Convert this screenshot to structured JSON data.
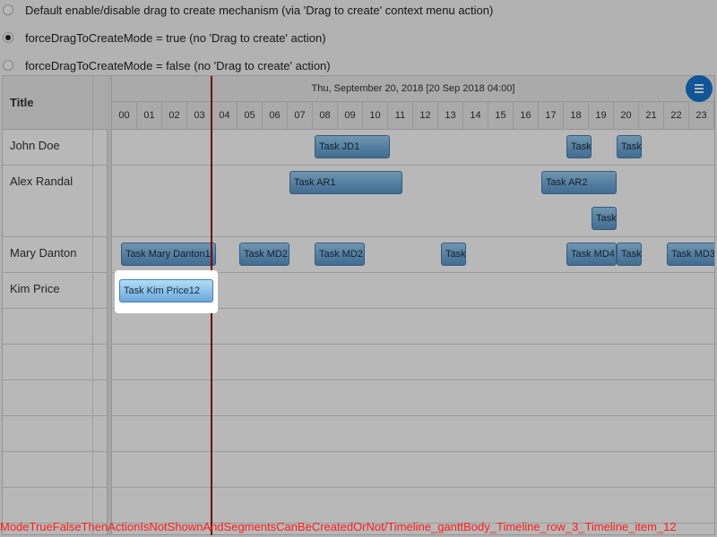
{
  "options": [
    {
      "label": "Default enable/disable drag to create mechanism (via 'Drag to create' context menu action)",
      "checked": false
    },
    {
      "label": "forceDragToCreateMode = true (no 'Drag to create' action)",
      "checked": true
    },
    {
      "label": "forceDragToCreateMode = false (no 'Drag to create' action)",
      "checked": false
    }
  ],
  "gantt": {
    "title_header": "Title",
    "date_label": "Thu, September 20, 2018 [20 Sep 2018 04:00]",
    "hours": [
      "00",
      "01",
      "02",
      "03",
      "04",
      "05",
      "06",
      "07",
      "08",
      "09",
      "10",
      "11",
      "12",
      "13",
      "14",
      "15",
      "16",
      "17",
      "18",
      "19",
      "20",
      "21",
      "22",
      "23"
    ],
    "rows": [
      "John Doe",
      "Alex Randal",
      "Mary Danton",
      "Kim Price"
    ],
    "tasks": {
      "jd1": "Task JD1",
      "jd2": "Task",
      "jd3": "Task",
      "ar1": "Task AR1",
      "ar2": "Task AR2",
      "ar3": "Task",
      "md1": "Task Mary Danton1",
      "md2": "Task MD2",
      "md3": "Task MD2",
      "md4": "Task",
      "md5": "Task MD4",
      "md6": "Task",
      "md7": "Task MD3",
      "kim": "Task Kim Price12"
    }
  },
  "debug_text": "ModeTrueFalseThenActionIsNotShownAndSegmentsCanBeCreatedOrNot/Timeline_ganttBody_Timeline_row_3_Timeline_item_12"
}
